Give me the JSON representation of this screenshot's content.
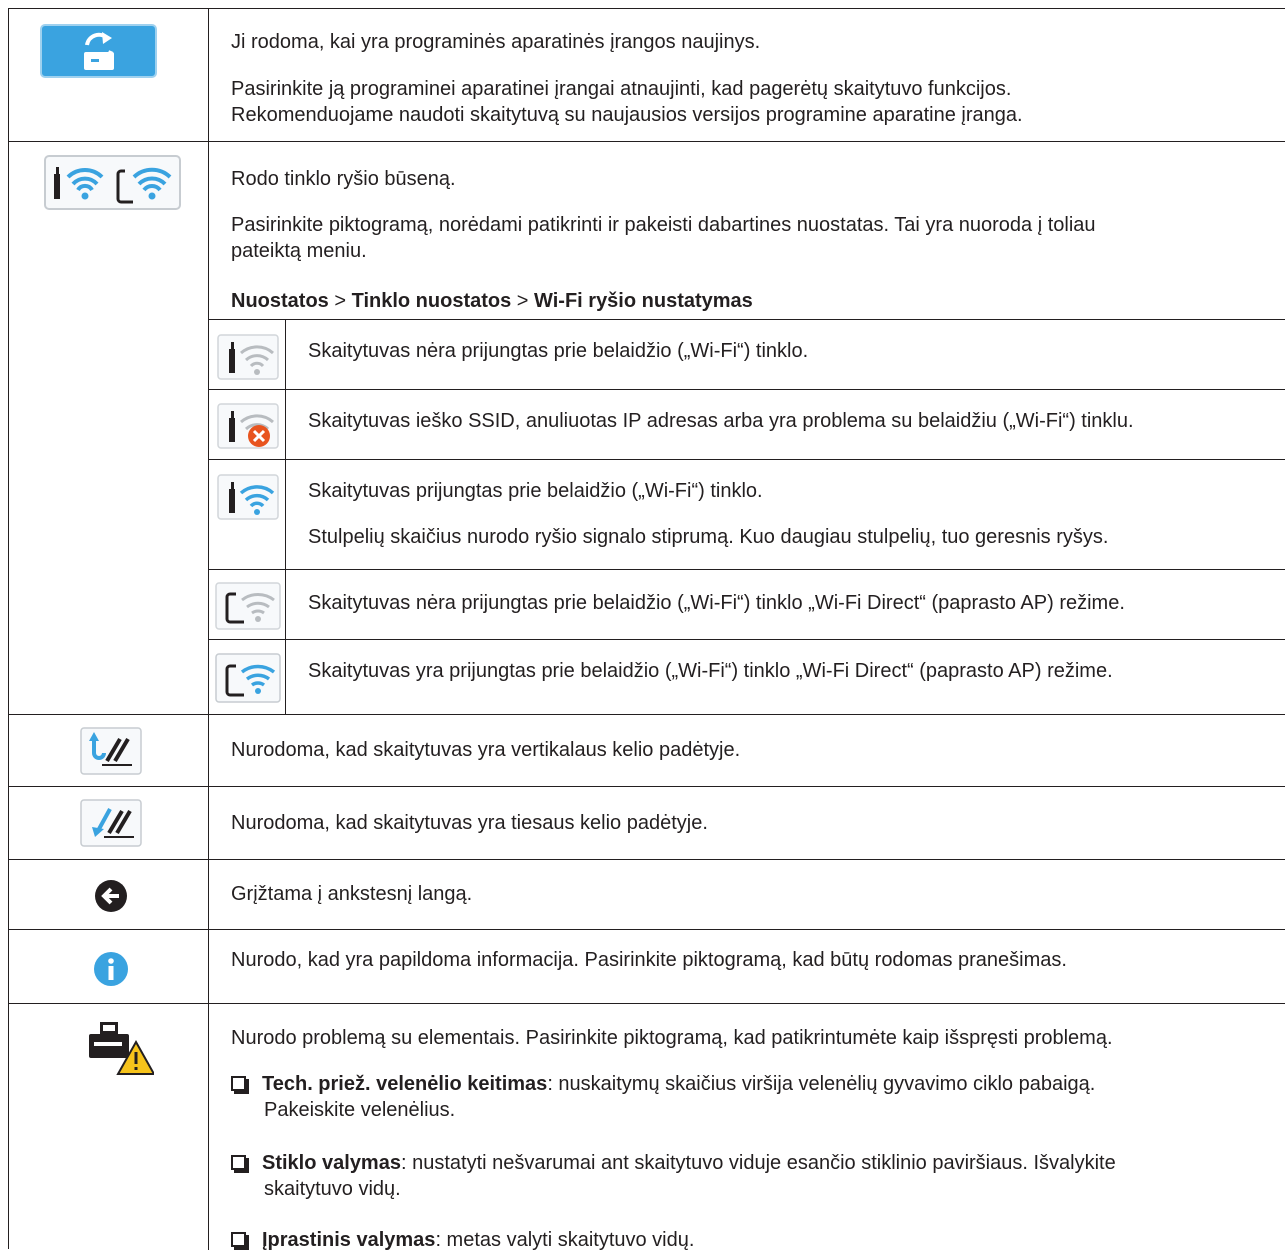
{
  "rows": {
    "firmware": {
      "icon": "firmware-update-icon",
      "lines": [
        "Ji rodoma, kai yra programinės aparatinės įrangos naujinys.",
        "Pasirinkite ją programinei aparatinei įrangai atnaujinti, kad pagerėtų skaitytuvo funkcijos.",
        "Rekomenduojame naudoti skaitytuvą su naujausios versijos programine aparatine įranga."
      ]
    },
    "network": {
      "icon": "network-status-icon",
      "lines": [
        "Rodo tinklo ryšio būseną.",
        "Pasirinkite piktogramą, norėdami patikrinti ir pakeisti dabartines nuostatas. Tai yra nuoroda į toliau",
        "pateiktą meniu."
      ],
      "path": {
        "p1": "Nuostatos",
        "sep1": " > ",
        "p2": "Tinklo nuostatos",
        "sep2": " > ",
        "p3": "Wi-Fi ryšio nustatymas"
      },
      "sub": [
        {
          "icon": "wifi-disconnected-icon",
          "text": "Skaitytuvas nėra prijungtas prie belaidžio („Wi-Fi“) tinklo."
        },
        {
          "icon": "wifi-error-icon",
          "text": "Skaitytuvas ieško SSID, anuliuotas IP adresas arba yra problema su belaidžiu („Wi-Fi“) tinklu."
        },
        {
          "icon": "wifi-connected-icon",
          "text": "Skaitytuvas prijungtas prie belaidžio („Wi-Fi“) tinklo.",
          "text2": "Stulpelių skaičius nurodo ryšio signalo stiprumą. Kuo daugiau stulpelių, tuo geresnis ryšys."
        },
        {
          "icon": "wifi-direct-disconnected-icon",
          "text": "Skaitytuvas nėra prijungtas prie belaidžio („Wi-Fi“) tinklo „Wi-Fi Direct“ (paprasto AP) režime."
        },
        {
          "icon": "wifi-direct-connected-icon",
          "text": "Skaitytuvas yra prijungtas prie belaidžio („Wi-Fi“) tinklo „Wi-Fi Direct“ (paprasto AP) režime."
        }
      ]
    },
    "upright": {
      "icon": "upright-path-icon",
      "text": "Nurodoma, kad skaitytuvas yra vertikalaus kelio padėtyje."
    },
    "straight": {
      "icon": "straight-path-icon",
      "text": "Nurodoma, kad skaitytuvas yra tiesaus kelio padėtyje."
    },
    "back": {
      "icon": "back-arrow-icon",
      "text": "Grįžtama į ankstesnį langą."
    },
    "info": {
      "icon": "info-icon",
      "text": "Nurodo, kad yra papildoma informacija. Pasirinkite piktogramą, kad būtų rodomas pranešimas."
    },
    "maintenance": {
      "icon": "scanner-warning-icon",
      "text": "Nurodo problemą su elementais. Pasirinkite piktogramą, kad patikrintumėte kaip išspręsti problemą.",
      "items": [
        {
          "term": "Tech. priež. velenėlio keitimas",
          "desc": ": nuskaitymų skaičius viršija velenėlių gyvavimo ciklo pabaigą.",
          "desc2": "Pakeiskite velenėlius."
        },
        {
          "term": "Stiklo valymas",
          "desc": ": nustatyti nešvarumai ant skaitytuvo viduje esančio stiklinio paviršiaus. Išvalykite",
          "desc2": "skaitytuvo vidų."
        },
        {
          "term": "Įprastinis valymas",
          "desc": ": metas valyti skaitytuvo vidų."
        }
      ]
    }
  },
  "colors": {
    "accent_blue": "#3aa3e0",
    "dark": "#231f20",
    "warning_yellow": "#f6c31b",
    "error_red": "#e8541f"
  }
}
